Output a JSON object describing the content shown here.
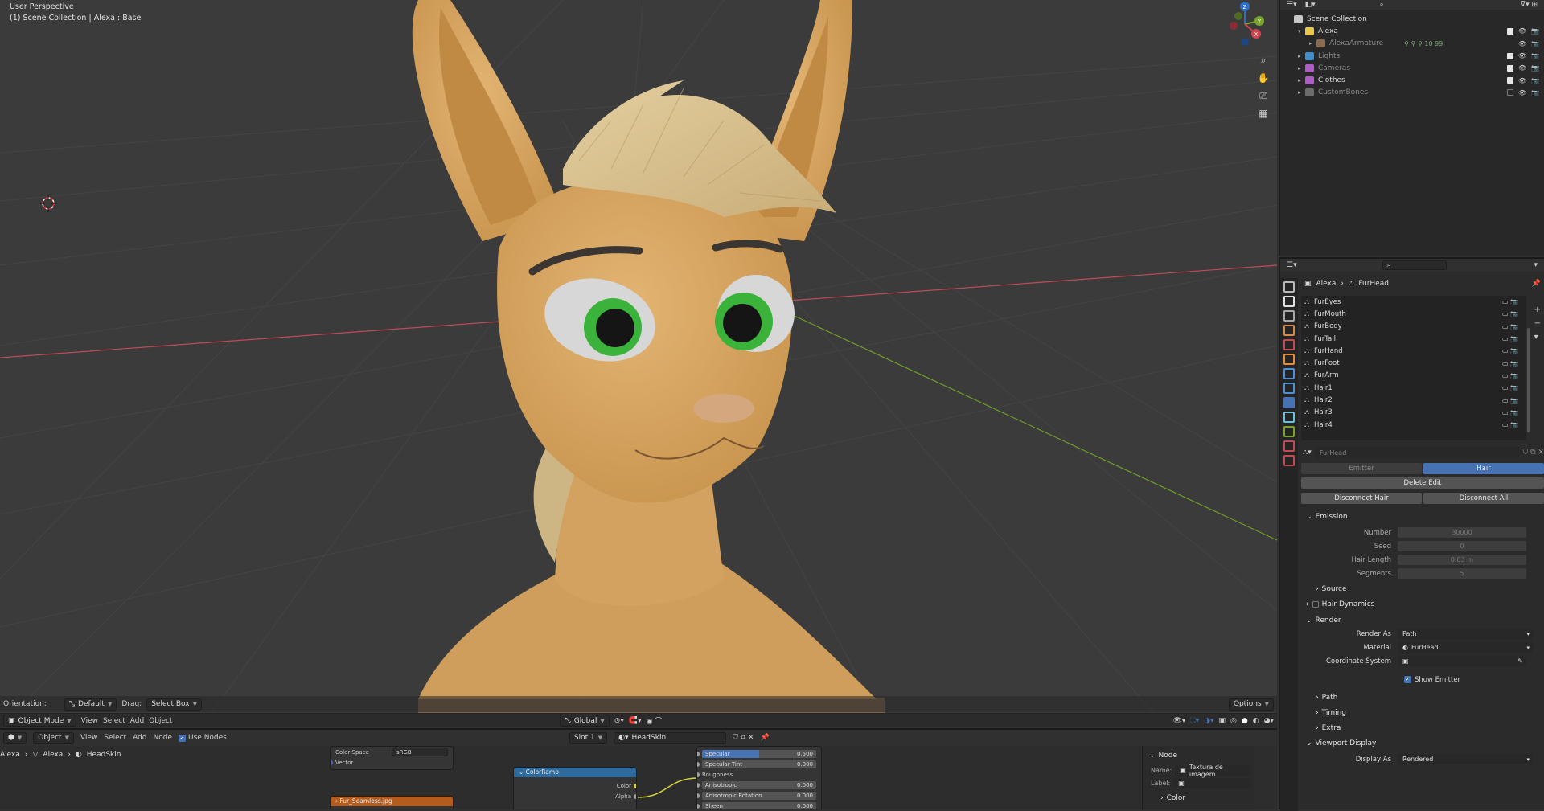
{
  "viewport": {
    "perspective": "User Perspective",
    "collection": "(1) Scene Collection | Alexa : Base",
    "gizmo_labels": [
      "Z",
      "X",
      "Y"
    ],
    "header": {
      "orientation_label": "Orientation:",
      "orientation_value": "Default",
      "drag_label": "Drag:",
      "drag_value": "Select Box",
      "options": "Options"
    },
    "toolbar": {
      "mode": "Object Mode",
      "menus": [
        "View",
        "Select",
        "Add",
        "Object"
      ],
      "transform": "Global"
    }
  },
  "node_editor": {
    "header": {
      "type": "Object",
      "menus": [
        "View",
        "Select",
        "Add",
        "Node"
      ],
      "use_nodes": "Use Nodes",
      "slot": "Slot 1",
      "material": "HeadSkin"
    },
    "breadcrumb": [
      "Alexa",
      "Alexa",
      "HeadSkin"
    ],
    "nodes": {
      "image": {
        "color_space_label": "Color Space",
        "color_space_value": "sRGB",
        "vector": "Vector"
      },
      "fur_image": "Fur_Seamless.jpg",
      "colorramp": {
        "title": "ColorRamp",
        "out_color": "Color",
        "out_alpha": "Alpha"
      },
      "bsdf_rows": [
        {
          "label": "Specular",
          "value": "0.500",
          "fill": 0.5
        },
        {
          "label": "Specular Tint",
          "value": "0.000",
          "fill": 0
        },
        {
          "label": "Roughness",
          "value": "",
          "fill": 0
        },
        {
          "label": "Anisotropic",
          "value": "0.000",
          "fill": 0
        },
        {
          "label": "Anisotropic Rotation",
          "value": "0.000",
          "fill": 0
        },
        {
          "label": "Sheen",
          "value": "0.000",
          "fill": 0
        }
      ]
    },
    "npanel": {
      "title": "Node",
      "name_label": "Name:",
      "name_value": "Textura de imagem",
      "label_label": "Label:",
      "color": "Color"
    }
  },
  "outliner": {
    "items": [
      {
        "name": "Scene Collection",
        "depth": 0,
        "icon": "collection-icon",
        "color": "#c8c8c8",
        "checked": null,
        "dim": false
      },
      {
        "name": "Alexa",
        "depth": 1,
        "icon": "collection-icon",
        "color": "#e8c84a",
        "checked": true,
        "dim": false
      },
      {
        "name": "AlexaArmature",
        "depth": 2,
        "icon": "armature-icon",
        "color": "#8a6b4e",
        "checked": null,
        "dim": true
      },
      {
        "name": "Lights",
        "depth": 1,
        "icon": "collection-icon",
        "color": "#3e8fd0",
        "checked": true,
        "dim": true
      },
      {
        "name": "Cameras",
        "depth": 1,
        "icon": "collection-icon",
        "color": "#b05cc8",
        "checked": true,
        "dim": true
      },
      {
        "name": "Clothes",
        "depth": 1,
        "icon": "collection-icon",
        "color": "#b05cc8",
        "checked": true,
        "dim": false
      },
      {
        "name": "CustomBones",
        "depth": 1,
        "icon": "collection-icon",
        "color": "#6c6c6c",
        "checked": false,
        "dim": true
      }
    ],
    "armature_count": "10",
    "armature_count2": "99"
  },
  "properties": {
    "breadcrumb_object": "Alexa",
    "breadcrumb_psys": "FurHead",
    "particle_systems": [
      "FurEyes",
      "FurMouth",
      "FurBody",
      "FurTail",
      "FurHand",
      "FurFoot",
      "FurArm",
      "Hair1",
      "Hair2",
      "Hair3",
      "Hair4"
    ],
    "settings_name": "FurHead",
    "type_tabs": [
      "Emitter",
      "Hair"
    ],
    "buttons": {
      "delete_edit": "Delete Edit",
      "disconnect_hair": "Disconnect Hair",
      "disconnect_all": "Disconnect All"
    },
    "emission": {
      "title": "Emission",
      "fields": [
        {
          "label": "Number",
          "value": "30000"
        },
        {
          "label": "Seed",
          "value": "0"
        },
        {
          "label": "Hair Length",
          "value": "0.03 m"
        },
        {
          "label": "Segments",
          "value": "5"
        }
      ],
      "source": "Source"
    },
    "hair_dynamics": "Hair Dynamics",
    "render": {
      "title": "Render",
      "render_as_label": "Render As",
      "render_as_value": "Path",
      "material_label": "Material",
      "material_value": "FurHead",
      "coord_label": "Coordinate System",
      "show_emitter": "Show Emitter",
      "subpanels": [
        "Path",
        "Timing",
        "Extra"
      ]
    },
    "viewport_display": {
      "title": "Viewport Display",
      "display_as_label": "Display As",
      "display_as_value": "Rendered"
    }
  },
  "colors": {
    "skin": "#d9a866",
    "hair": "#d8c08e",
    "iris": "#3bb33b",
    "accent_blue": "#4772b3",
    "x_axis": "#d0434f",
    "y_axis": "#7aa32c"
  }
}
